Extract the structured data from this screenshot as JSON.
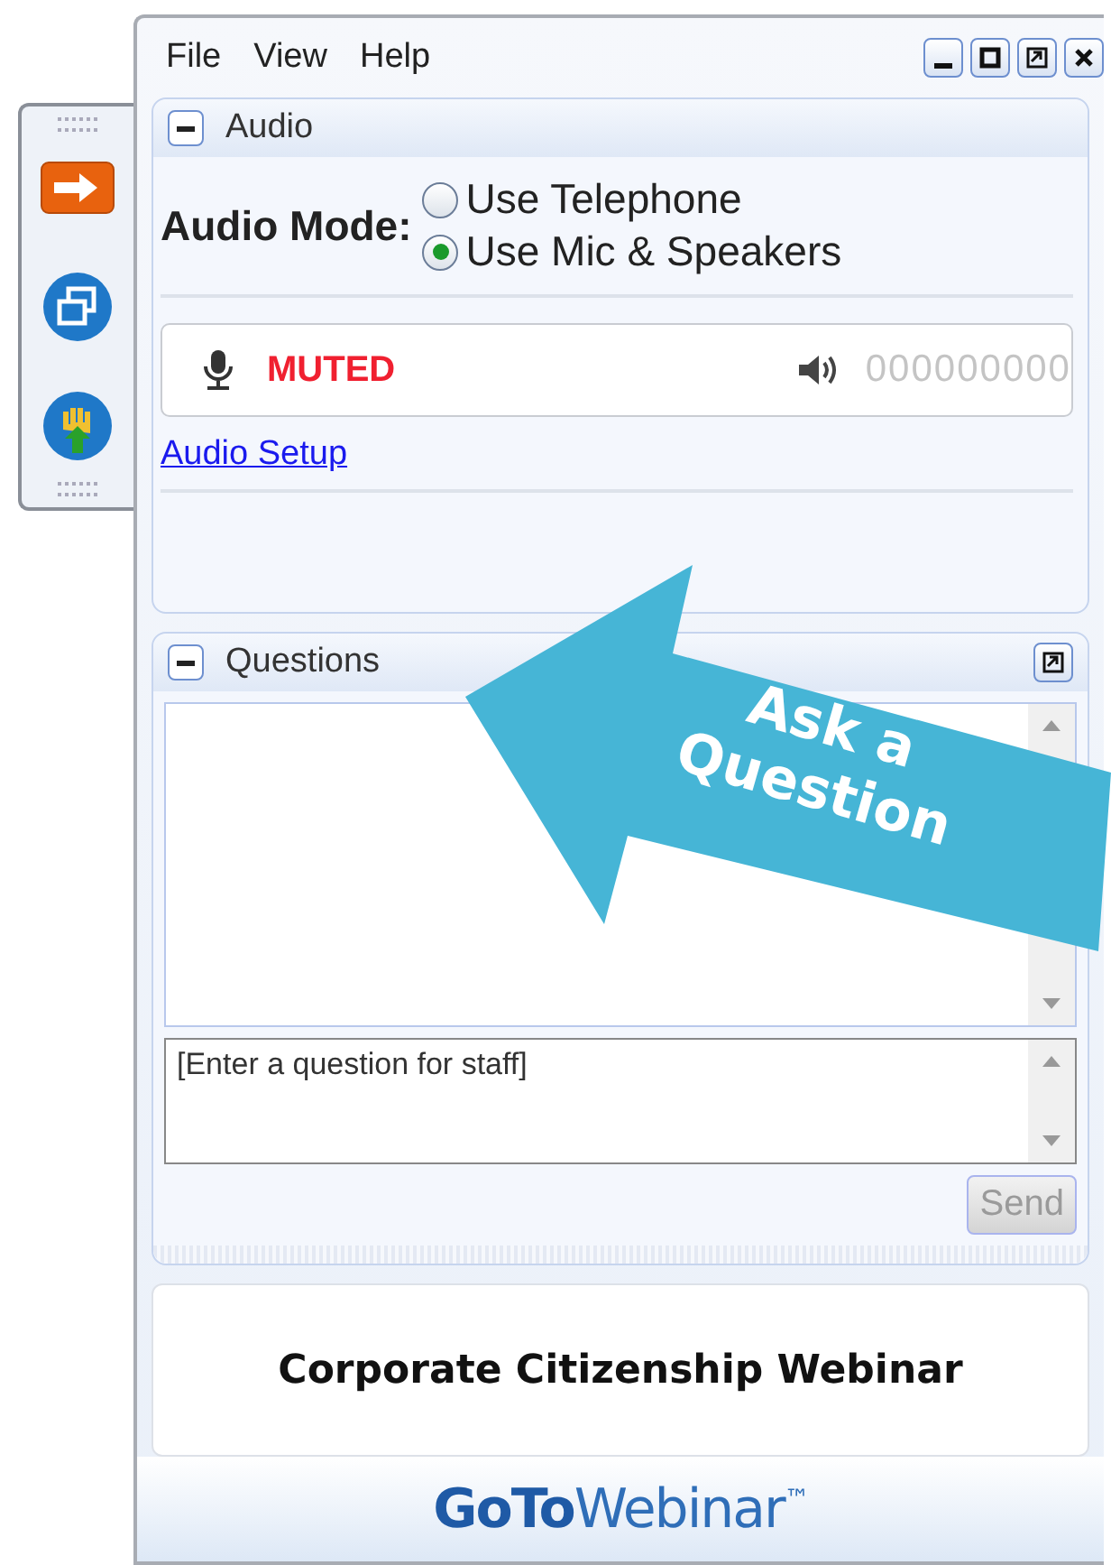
{
  "menu": [
    {
      "label": "File"
    },
    {
      "label": "View"
    },
    {
      "label": "Help"
    }
  ],
  "audio_panel": {
    "title": "Audio",
    "expanded": true,
    "mode_label": "Audio Mode:",
    "options": [
      {
        "label": "Use Telephone",
        "selected": false
      },
      {
        "label": "Use Mic & Speakers",
        "selected": true
      }
    ],
    "mic_status": "MUTED",
    "speaker_reading": "000000000",
    "setup_link": "Audio Setup"
  },
  "questions_panel": {
    "title": "Questions",
    "expanded": true,
    "input": {
      "placeholder": "[Enter a question for staff]"
    },
    "send_button": {
      "label": "Send",
      "disabled": true
    }
  },
  "webinar_title": "Corporate Citizenship Webinar",
  "logo": "**GoTo**Webinar$^{™}$",
  "annotation": {
    "text": "Ask a Question"
  }
}
